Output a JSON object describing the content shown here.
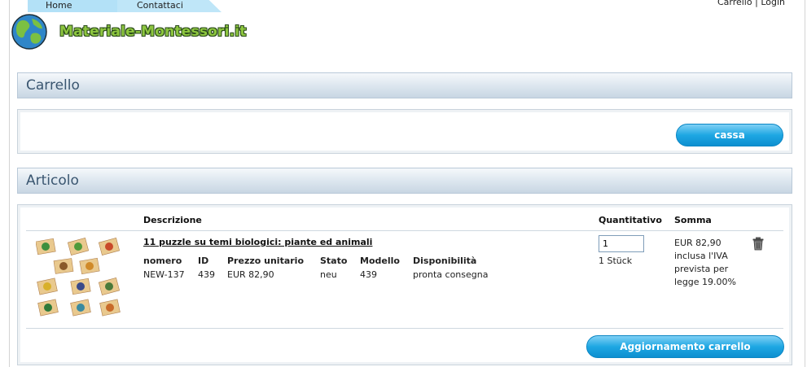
{
  "nav": {
    "tabs": [
      "Home",
      "Contattaci"
    ]
  },
  "header": {
    "cart_link": "Carrello",
    "separator": "|",
    "login_link": "Login",
    "logo_text": "Materiale-Montessori.it"
  },
  "cart_section": {
    "title": "Carrello",
    "checkout_button": "cassa"
  },
  "articles_section": {
    "title": "Articolo",
    "columns": {
      "description": "Descrizione",
      "quantity": "Quantitativo",
      "sum": "Somma"
    },
    "item": {
      "name": "11 puzzle su temi biologici: piante ed animali",
      "attr_headers": [
        "nomero",
        "ID",
        "Prezzo unitario",
        "Stato",
        "Modello",
        "Disponibilità"
      ],
      "attr_values": [
        "NEW-137",
        "439",
        "EUR 82,90",
        "neu",
        "439",
        "pronta consegna"
      ],
      "quantity": "1",
      "quantity_unit": "1 Stück",
      "price_lines": [
        "EUR 82,90",
        "inclusa l'IVA",
        "prevista per",
        "legge 19.00%"
      ]
    },
    "update_button": "Aggiornamento carrello"
  },
  "colors": {
    "accent_blue": "#1ea7e3",
    "section_text": "#3a5670",
    "logo_green": "#8dc63f",
    "tab_blue": "#b3e1f7"
  },
  "icons": [
    "globe-logo-icon",
    "trash-icon"
  ]
}
